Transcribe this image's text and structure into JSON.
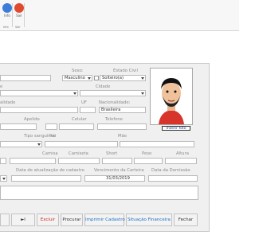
{
  "ribbon": {
    "info_label": "Info",
    "sair_label": "Sair",
    "group_info": "Info",
    "group_sair": "Sair"
  },
  "form": {
    "sexo_label": "Sexo:",
    "sexo_value": "Masculino",
    "estado_civil_label": "Estado Civil",
    "estado_civil_value": "Solteiro(a)",
    "e_label": "e",
    "cidade_label": "Cidade",
    "naturalidade_label": "alidade",
    "uf_label": "UF",
    "nacionalidade_label": "Nacionalidade:",
    "nacionalidade_value": "Brasileira",
    "apelido_label": "Apelido",
    "celular_label": "Celular",
    "telefone_label": "Telefone",
    "tipo_sanguineo_label": "Tipo sanguíneo",
    "pai_label": "Pai",
    "mae_label": "Mãe",
    "camisa_label": "Camisa",
    "camiseta_label": "Camiseta",
    "short_label": "Short",
    "peso_label": "Peso",
    "altura_label": "Altura",
    "data_atualizacao_label": "Data de atualização de cadastro",
    "vencimento_label": "Vencimento da Carteira",
    "vencimento_value": "31/03/2019",
    "data_demissao_label": "Data da Demissão"
  },
  "photo": {
    "button_label": "Inserir foto"
  },
  "toolbar": {
    "last_label": "►I",
    "excluir_label": "Excluir",
    "procurar_label": "Procurar",
    "imprimir_label": "Imprimir Cadastro",
    "situacao_label": "Situação Financeira",
    "fechar_label": "Fechar"
  },
  "colors": {
    "info_icon": "#3b7dd8",
    "sair_icon": "#e04a2f",
    "excluir": "#cc2a1f",
    "imprimir": "#1f6fc1",
    "situacao": "#1f6fc1"
  },
  "icons": {
    "info": "info-icon",
    "sair": "exit-icon"
  }
}
